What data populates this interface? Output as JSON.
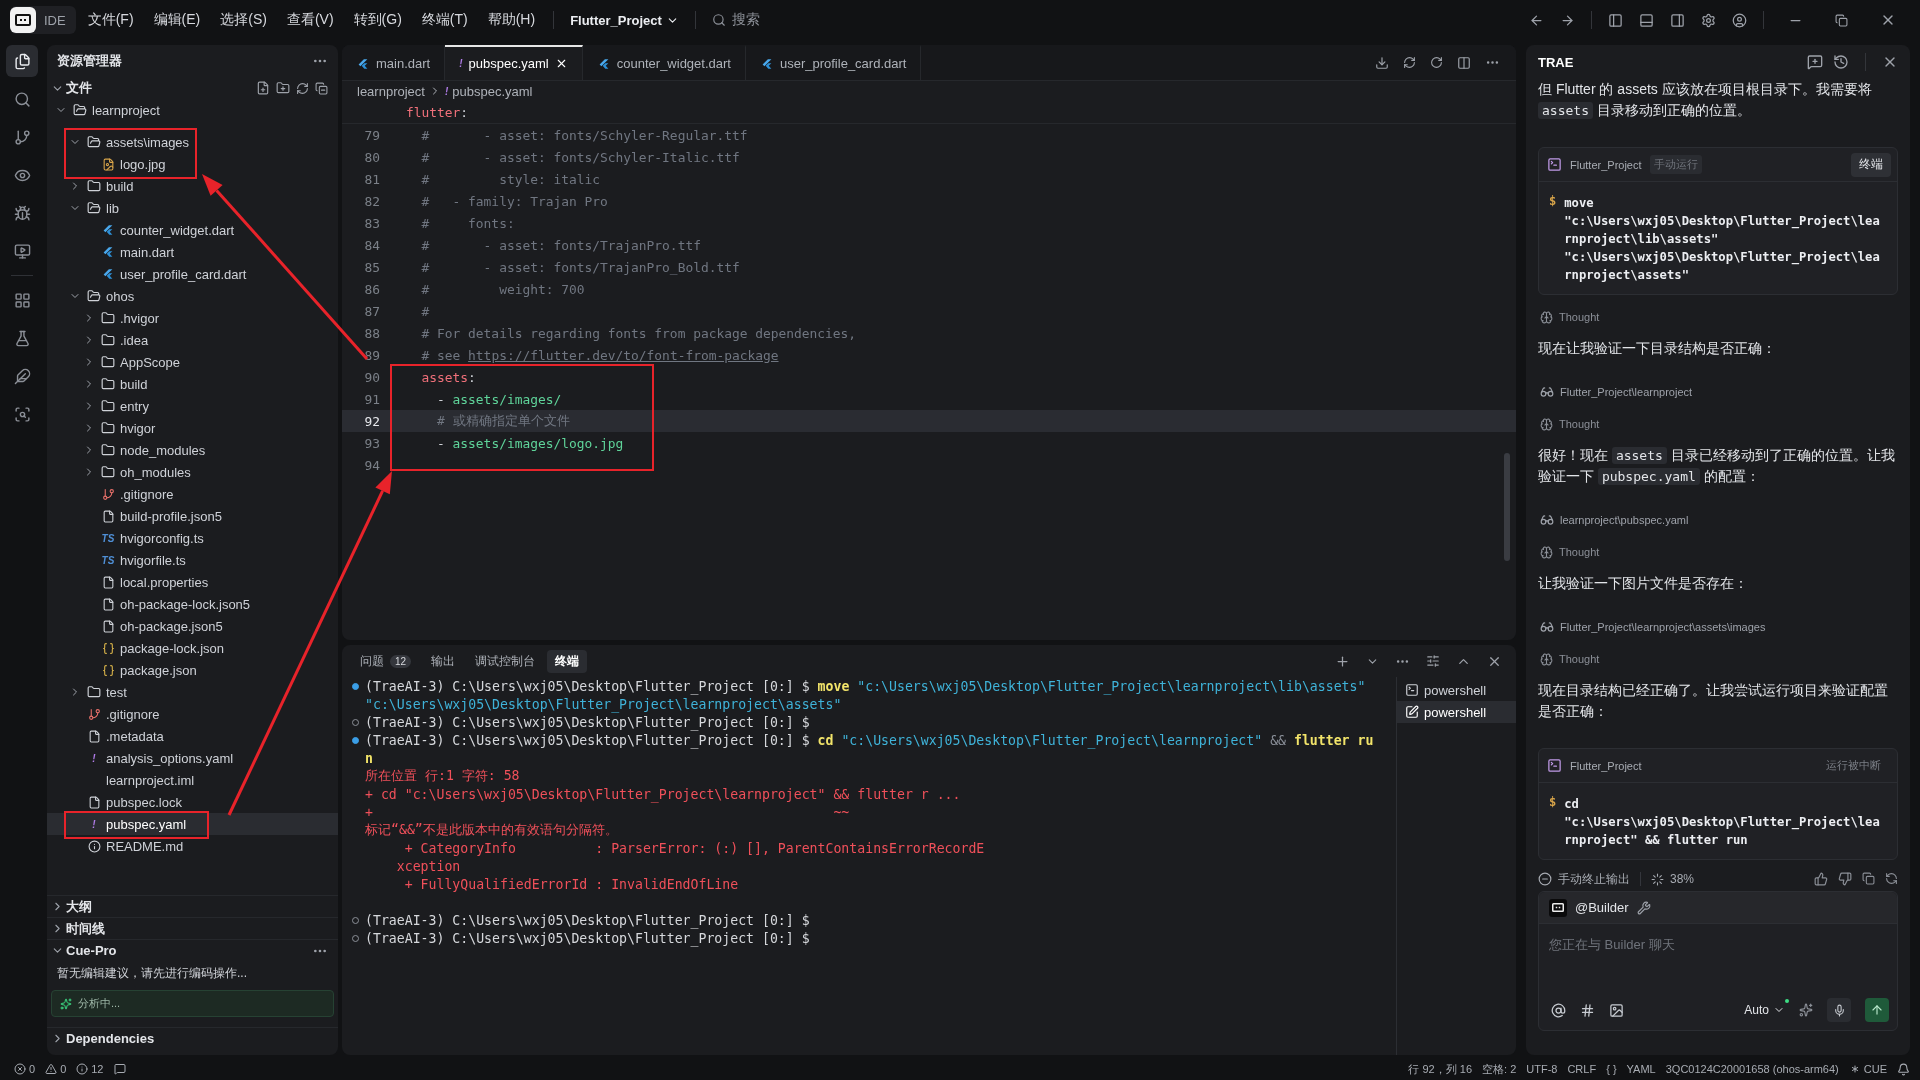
{
  "titlebar": {
    "app_label": "IDE",
    "menus": [
      "文件(F)",
      "编辑(E)",
      "选择(S)",
      "查看(V)",
      "转到(G)",
      "终端(T)",
      "帮助(H)"
    ],
    "project": "Flutter_Project",
    "search": "搜索"
  },
  "activity_bar": [
    {
      "selected": true
    },
    {
      "selected": false
    },
    {
      "selected": false
    },
    {
      "selected": false
    },
    {
      "selected": false
    },
    {
      "selected": false
    },
    {
      "selected": false
    },
    {
      "selected": false
    },
    {
      "selected": false
    },
    {
      "selected": false
    }
  ],
  "explorer": {
    "title": "资源管理器",
    "section": "文件",
    "tree": [
      {
        "name": "learnproject",
        "kind": "folder",
        "expanded": true,
        "selected": false,
        "children": [
          {
            "name": "assets\\images",
            "kind": "folder",
            "expanded": true,
            "selected": false,
            "children": [
              {
                "name": "logo.jpg",
                "kind": "image",
                "selected": false
              }
            ]
          },
          {
            "name": "build",
            "kind": "folder",
            "expanded": false,
            "selected": false
          },
          {
            "name": "lib",
            "kind": "folder",
            "expanded": true,
            "selected": false,
            "children": [
              {
                "name": "counter_widget.dart",
                "kind": "dart",
                "selected": false
              },
              {
                "name": "main.dart",
                "kind": "dart",
                "selected": false
              },
              {
                "name": "user_profile_card.dart",
                "kind": "dart",
                "selected": false
              }
            ]
          },
          {
            "name": "ohos",
            "kind": "folder",
            "expanded": true,
            "selected": false,
            "children": [
              {
                "name": ".hvigor",
                "kind": "folder",
                "expanded": false,
                "selected": false
              },
              {
                "name": ".idea",
                "kind": "folder",
                "expanded": false,
                "selected": false
              },
              {
                "name": "AppScope",
                "kind": "folder",
                "expanded": false,
                "selected": false
              },
              {
                "name": "build",
                "kind": "folder",
                "expanded": false,
                "selected": false
              },
              {
                "name": "entry",
                "kind": "folder",
                "expanded": false,
                "selected": false
              },
              {
                "name": "hvigor",
                "kind": "folder",
                "expanded": false,
                "selected": false
              },
              {
                "name": "node_modules",
                "kind": "folder",
                "expanded": false,
                "selected": false
              },
              {
                "name": "oh_modules",
                "kind": "folder",
                "expanded": false,
                "selected": false
              },
              {
                "name": ".gitignore",
                "kind": "git",
                "selected": false
              },
              {
                "name": "build-profile.json5",
                "kind": "file",
                "selected": false
              },
              {
                "name": "hvigorconfig.ts",
                "kind": "ts",
                "badge": "TS",
                "selected": false
              },
              {
                "name": "hvigorfile.ts",
                "kind": "ts",
                "badge": "TS",
                "selected": false
              },
              {
                "name": "local.properties",
                "kind": "file",
                "selected": false
              },
              {
                "name": "oh-package-lock.json5",
                "kind": "file",
                "selected": false
              },
              {
                "name": "oh-package.json5",
                "kind": "file",
                "selected": false
              },
              {
                "name": "package-lock.json",
                "kind": "json",
                "selected": false
              },
              {
                "name": "package.json",
                "kind": "json",
                "selected": false
              }
            ]
          },
          {
            "name": "test",
            "kind": "folder",
            "expanded": false,
            "selected": false
          },
          {
            "name": ".gitignore",
            "kind": "git",
            "selected": false
          },
          {
            "name": ".metadata",
            "kind": "file",
            "selected": false
          },
          {
            "name": "analysis_options.yaml",
            "kind": "yaml",
            "badge": "!",
            "selected": false
          },
          {
            "name": "learnproject.iml",
            "kind": "xml",
            "selected": false
          },
          {
            "name": "pubspec.lock",
            "kind": "file",
            "selected": false
          },
          {
            "name": "pubspec.yaml",
            "kind": "yaml",
            "badge": "!",
            "selected": true
          },
          {
            "name": "README.md",
            "kind": "info",
            "selected": false
          }
        ]
      }
    ],
    "panels": [
      {
        "title": "大纲",
        "expanded": false
      },
      {
        "title": "时间线",
        "expanded": false
      },
      {
        "title": "Cue-Pro",
        "expanded": true,
        "message": "暂无编辑建议，请先进行编码操作...",
        "status": "分析中..."
      },
      {
        "title": "Dependencies",
        "expanded": false
      }
    ]
  },
  "editor": {
    "tabs": [
      {
        "label": "main.dart",
        "kind": "dart",
        "selected": false
      },
      {
        "label": "pubspec.yaml",
        "kind": "yaml",
        "badge": "!",
        "selected": true
      },
      {
        "label": "counter_widget.dart",
        "kind": "dart",
        "selected": false
      },
      {
        "label": "user_profile_card.dart",
        "kind": "dart",
        "selected": false
      }
    ],
    "breadcrumb": [
      {
        "label": "learnproject",
        "kind": "folder"
      },
      {
        "label": "pubspec.yaml",
        "kind": "yaml",
        "badge": "!"
      }
    ],
    "sticky": [
      {
        "text": "flutter",
        "kind": "key"
      },
      {
        "text": ":",
        "kind": "punct"
      }
    ],
    "lines": [
      {
        "number": "79",
        "current": false,
        "tokens": [
          {
            "text": "  #       - asset: fonts/Schyler-Regular.ttf",
            "kind": "comment"
          }
        ]
      },
      {
        "number": "80",
        "current": false,
        "tokens": [
          {
            "text": "  #       - asset: fonts/Schyler-Italic.ttf",
            "kind": "comment"
          }
        ]
      },
      {
        "number": "81",
        "current": false,
        "tokens": [
          {
            "text": "  #         style: italic",
            "kind": "comment"
          }
        ]
      },
      {
        "number": "82",
        "current": false,
        "tokens": [
          {
            "text": "  #   - family: Trajan Pro",
            "kind": "comment"
          }
        ]
      },
      {
        "number": "83",
        "current": false,
        "tokens": [
          {
            "text": "  #     fonts:",
            "kind": "comment"
          }
        ]
      },
      {
        "number": "84",
        "current": false,
        "tokens": [
          {
            "text": "  #       - asset: fonts/TrajanPro.ttf",
            "kind": "comment"
          }
        ]
      },
      {
        "number": "85",
        "current": false,
        "tokens": [
          {
            "text": "  #       - asset: fonts/TrajanPro_Bold.ttf",
            "kind": "comment"
          }
        ]
      },
      {
        "number": "86",
        "current": false,
        "tokens": [
          {
            "text": "  #         weight: 700",
            "kind": "comment"
          }
        ]
      },
      {
        "number": "87",
        "current": false,
        "tokens": [
          {
            "text": "  #",
            "kind": "comment"
          }
        ]
      },
      {
        "number": "88",
        "current": false,
        "tokens": [
          {
            "text": "  # For details regarding fonts from package dependencies,",
            "kind": "comment"
          }
        ]
      },
      {
        "number": "89",
        "current": false,
        "tokens": [
          {
            "text": "  # see ",
            "kind": "comment"
          },
          {
            "text": "https://flutter.dev/to/font-from-package",
            "kind": "link"
          }
        ]
      },
      {
        "number": "90",
        "current": false,
        "tokens": [
          {
            "text": "  assets",
            "kind": "key"
          },
          {
            "text": ":",
            "kind": "punct"
          }
        ]
      },
      {
        "number": "91",
        "current": false,
        "tokens": [
          {
            "text": "    - ",
            "kind": "punct"
          },
          {
            "text": "assets/images/",
            "kind": "string"
          }
        ]
      },
      {
        "number": "92",
        "current": true,
        "tokens": [
          {
            "text": "    # 或精确指定单个文件",
            "kind": "comment"
          }
        ]
      },
      {
        "number": "93",
        "current": false,
        "tokens": [
          {
            "text": "    - ",
            "kind": "punct"
          },
          {
            "text": "assets/images/logo.jpg",
            "kind": "string"
          }
        ]
      },
      {
        "number": "94",
        "current": false
      }
    ]
  },
  "panel": {
    "tabs": [
      {
        "label": "问题",
        "count": "12",
        "selected": false
      },
      {
        "label": "输出",
        "selected": false
      },
      {
        "label": "调试控制台",
        "selected": false
      },
      {
        "label": "终端",
        "selected": true
      }
    ],
    "terminal_lines": [
      {
        "kind": "done",
        "tokens": [
          {
            "text": "(TraeAI-3) C:\\Users\\wxj05\\Desktop\\Flutter_Project [0:] $ ",
            "kind": "plain"
          },
          {
            "text": "move",
            "kind": "command"
          },
          {
            "text": " \"c:\\Users\\wxj05\\Desktop\\Flutter_Project\\learnproject\\lib\\assets\"",
            "kind": "string"
          }
        ]
      },
      {
        "kind": "output",
        "tokens": [
          {
            "text": "\"c:\\Users\\wxj05\\Desktop\\Flutter_Project\\learnproject\\assets\"",
            "kind": "string"
          }
        ]
      },
      {
        "kind": "idle",
        "tokens": [
          {
            "text": "(TraeAI-3) C:\\Users\\wxj05\\Desktop\\Flutter_Project [0:] $",
            "kind": "plain"
          }
        ]
      },
      {
        "kind": "done",
        "tokens": [
          {
            "text": "(TraeAI-3) C:\\Users\\wxj05\\Desktop\\Flutter_Project [0:] $ ",
            "kind": "plain"
          },
          {
            "text": "cd",
            "kind": "command"
          },
          {
            "text": " \"c:\\Users\\wxj05\\Desktop\\Flutter_Project\\learnproject\"",
            "kind": "string"
          },
          {
            "text": " && ",
            "kind": "op"
          },
          {
            "text": "flutter ru",
            "kind": "command"
          }
        ]
      },
      {
        "kind": "output",
        "tokens": [
          {
            "text": "n",
            "kind": "command"
          }
        ]
      },
      {
        "kind": "output",
        "tokens": [
          {
            "text": "所在位置 行:1 字符: 58",
            "kind": "error"
          }
        ]
      },
      {
        "kind": "output",
        "tokens": [
          {
            "text": "+ cd \"c:\\Users\\wxj05\\Desktop\\Flutter_Project\\learnproject\" && flutter r ...",
            "kind": "error"
          }
        ]
      },
      {
        "kind": "output",
        "tokens": [
          {
            "text": "+                                                          ~~",
            "kind": "error"
          }
        ]
      },
      {
        "kind": "output",
        "tokens": [
          {
            "text": "标记“&&”不是此版本中的有效语句分隔符。",
            "kind": "error"
          }
        ]
      },
      {
        "kind": "output",
        "tokens": [
          {
            "text": "     + CategoryInfo          : ParserError: (:) [], ParentContainsErrorRecordE",
            "kind": "error"
          }
        ]
      },
      {
        "kind": "output",
        "tokens": [
          {
            "text": "    xception",
            "kind": "error"
          }
        ]
      },
      {
        "kind": "output",
        "tokens": [
          {
            "text": "     + FullyQualifiedErrorId : InvalidEndOfLine",
            "kind": "error"
          }
        ]
      },
      {
        "kind": "blank"
      },
      {
        "kind": "idle",
        "tokens": [
          {
            "text": "(TraeAI-3) C:\\Users\\wxj05\\Desktop\\Flutter_Project [0:] $",
            "kind": "plain"
          }
        ]
      },
      {
        "kind": "idle",
        "tokens": [
          {
            "text": "(TraeAI-3) C:\\Users\\wxj05\\Desktop\\Flutter_Project [0:] $",
            "kind": "plain"
          }
        ]
      }
    ],
    "shells": [
      {
        "label": "powershell",
        "kind": "terminal",
        "selected": false
      },
      {
        "label": "powershell",
        "kind": "task",
        "selected": true
      }
    ]
  },
  "assistant": {
    "title": "TRAE",
    "messages": [
      {
        "kind": "paragraph",
        "parts": [
          {
            "text": "但 Flutter 的 assets 应该放在项目根目录下。我需要将 "
          },
          {
            "text": "assets",
            "code": true
          },
          {
            "text": " 目录移动到正确的位置。"
          }
        ]
      },
      {
        "kind": "command",
        "project": "Flutter_Project",
        "badge": "手动运行",
        "button": "终端",
        "prompt": "$",
        "command": "move \"c:\\Users\\wxj05\\Desktop\\Flutter_Project\\learnproject\\lib\\assets\" \"c:\\Users\\wxj05\\Desktop\\Flutter_Project\\learnproject\\assets\""
      },
      {
        "kind": "thought",
        "text": "Thought"
      },
      {
        "kind": "paragraph",
        "parts": [
          {
            "text": "现在让我验证一下目录结构是否正确："
          }
        ]
      },
      {
        "kind": "file",
        "text": "Flutter_Project\\learnproject"
      },
      {
        "kind": "thought",
        "text": "Thought"
      },
      {
        "kind": "paragraph",
        "parts": [
          {
            "text": "很好！现在 "
          },
          {
            "text": "assets",
            "code": true
          },
          {
            "text": " 目录已经移动到了正确的位置。让我验证一下 "
          },
          {
            "text": "pubspec.yaml",
            "code": true
          },
          {
            "text": " 的配置："
          }
        ]
      },
      {
        "kind": "file",
        "text": "learnproject\\pubspec.yaml"
      },
      {
        "kind": "thought",
        "text": "Thought"
      },
      {
        "kind": "paragraph",
        "parts": [
          {
            "text": "让我验证一下图片文件是否存在："
          }
        ]
      },
      {
        "kind": "file",
        "text": "Flutter_Project\\learnproject\\assets\\images"
      },
      {
        "kind": "thought",
        "text": "Thought"
      },
      {
        "kind": "paragraph",
        "parts": [
          {
            "text": "现在目录结构已经正确了。让我尝试运行项目来验证配置是否正确："
          }
        ]
      },
      {
        "kind": "command",
        "project": "Flutter_Project",
        "status": "运行被中断",
        "prompt": "$",
        "command": "cd \"c:\\Users\\wxj05\\Desktop\\Flutter_Project\\learnproject\" && flutter run"
      }
    ],
    "stop_label": "手动终止输出",
    "progress": "38%",
    "agent": "@Builder",
    "placeholder": "您正在与 Builder 聊天",
    "model": "Auto"
  },
  "status_bar": {
    "problems": [
      {
        "kind": "error",
        "count": "0"
      },
      {
        "kind": "warning",
        "count": "0"
      },
      {
        "kind": "info",
        "count": "12"
      }
    ],
    "items": [
      {
        "text": "行 92，列 16",
        "kind": "text"
      },
      {
        "text": "空格: 2",
        "kind": "text"
      },
      {
        "text": "UTF-8",
        "kind": "text"
      },
      {
        "text": "CRLF",
        "kind": "text"
      },
      {
        "text": "{ }",
        "kind": "text"
      },
      {
        "text": "YAML",
        "kind": "text"
      },
      {
        "text": "3QC0124C20001658 (ohos-arm64)",
        "kind": "text"
      },
      {
        "text": "CUE",
        "kind": "cue"
      }
    ]
  }
}
